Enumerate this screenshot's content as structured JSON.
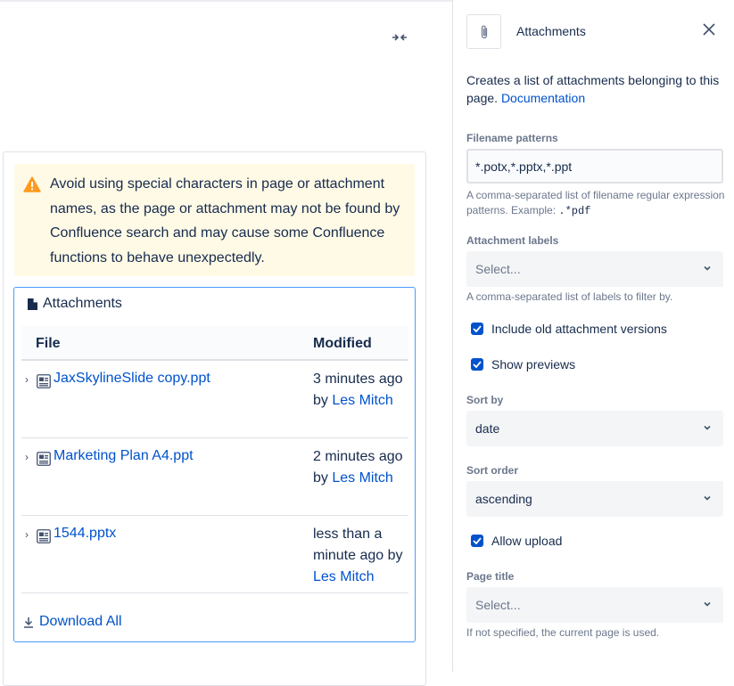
{
  "editor": {
    "warning_text": "Avoid using special characters in page or attachment names, as the page or attachment may not be found by Confluence search and may cause some Confluence functions to behave unexpectedly.",
    "attachments_title": "Attachments",
    "table": {
      "headers": {
        "file": "File",
        "modified": "Modified"
      },
      "rows": [
        {
          "name": "JaxSkylineSlide copy.ppt",
          "modified_prefix": "3 minutes ago by",
          "modified_by": "Les Mitch"
        },
        {
          "name": "Marketing Plan A4.ppt",
          "modified_prefix": "2 minutes ago by",
          "modified_by": "Les Mitch"
        },
        {
          "name": "1544.pptx",
          "modified_prefix": "less than a minute ago by",
          "modified_by": "Les Mitch"
        }
      ]
    },
    "download_all": "Download All"
  },
  "panel": {
    "title": "Attachments",
    "description": "Creates a list of attachments belonging to this page.",
    "documentation_link": "Documentation",
    "filename_patterns": {
      "label": "Filename patterns",
      "value": "*.potx,*.pptx,*.ppt",
      "help_prefix": "A comma-separated list of filename regular expression patterns. Example:",
      "help_example": ".*pdf"
    },
    "attachment_labels": {
      "label": "Attachment labels",
      "placeholder": "Select...",
      "help": "A comma-separated list of labels to filter by."
    },
    "include_old_versions": {
      "label": "Include old attachment versions",
      "checked": true
    },
    "show_previews": {
      "label": "Show previews",
      "checked": true
    },
    "sort_by": {
      "label": "Sort by",
      "value": "date"
    },
    "sort_order": {
      "label": "Sort order",
      "value": "ascending"
    },
    "allow_upload": {
      "label": "Allow upload",
      "checked": true
    },
    "page_title": {
      "label": "Page title",
      "placeholder": "Select...",
      "help": "If not specified, the current page is used."
    }
  },
  "colors": {
    "link": "#0052cc",
    "checkbox": "#0052cc",
    "warning_bg": "#fffae6",
    "warning_icon": "#ff991f",
    "focus_border": "#4c9aff"
  }
}
